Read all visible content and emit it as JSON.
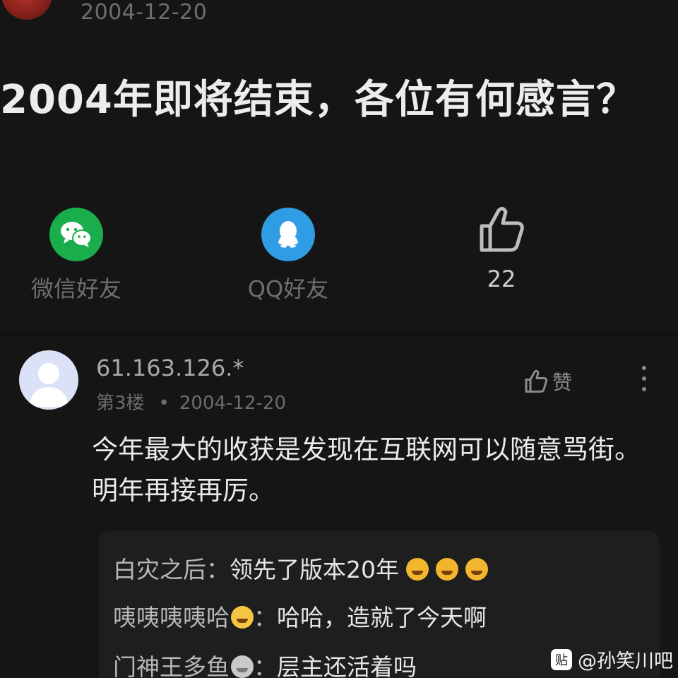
{
  "header": {
    "date": "2004-12-20"
  },
  "post": {
    "title": "2004年即将结束，各位有何感言？"
  },
  "share": {
    "wechat_label": "微信好友",
    "qq_label": "QQ好友",
    "like_count": "22"
  },
  "comment": {
    "user": "61.163.126.*",
    "floor": "第3楼",
    "separator": "•",
    "date": "2004-12-20",
    "like_label": "赞",
    "body": "今年最大的收获是发现在互联网可以随意骂街。明年再接再厉。",
    "replies": [
      {
        "user": "白灾之后",
        "colon": "：",
        "text": "领先了版本20年",
        "emojis": [
          "grin-emoji",
          "grin-emoji",
          "grin-emoji"
        ]
      },
      {
        "user": "咦咦咦咦哈",
        "colon": "：",
        "text": "哈哈，造就了今天啊",
        "emojis": [
          "laugh-cry-emoji"
        ]
      },
      {
        "user": "门神王多鱼",
        "colon": "：",
        "text": "层主还活着吗",
        "emojis": [
          "mouse-emoji"
        ]
      }
    ]
  },
  "watermark": {
    "logo": "贴",
    "text": "@孙笑川吧"
  }
}
